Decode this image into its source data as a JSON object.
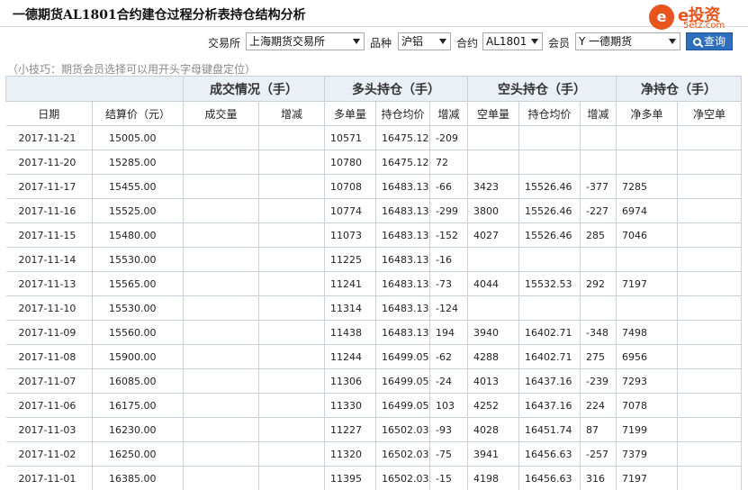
{
  "header": {
    "title": "一德期货AL1801合约建仓过程分析表持仓结构分析",
    "logo_mark": "e",
    "logo_brand": "e投资",
    "logo_site": "5etz.com"
  },
  "filters": {
    "exchange_label": "交易所",
    "exchange_value": "上海期货交易所",
    "variety_label": "品种",
    "variety_value": "沪铝",
    "contract_label": "合约",
    "contract_value": "AL1801",
    "member_label": "会员",
    "member_value": "Y 一德期货",
    "query_label": "查询"
  },
  "tip": "（小技巧：期货会员选择可以用开头字母键盘定位）",
  "table": {
    "group_headers": [
      "成交情况（手）",
      "多头持仓（手）",
      "空头持仓（手）",
      "净持仓（手）"
    ],
    "columns": [
      "日期",
      "结算价（元）",
      "成交量",
      "增减",
      "多单量",
      "持仓均价",
      "增减",
      "空单量",
      "持仓均价",
      "增减",
      "净多单",
      "净空单"
    ],
    "rows": [
      {
        "date": "2017-11-21",
        "settle": "15005.00",
        "long_qty": "10571",
        "long_avg": "16475.12",
        "long_chg": "-209",
        "long_dir": "down",
        "short_qty": "",
        "short_avg": "",
        "short_chg": "",
        "short_dir": "",
        "net_long": "",
        "net_short": ""
      },
      {
        "date": "2017-11-20",
        "settle": "15285.00",
        "long_qty": "10780",
        "long_avg": "16475.12",
        "long_chg": "72",
        "long_dir": "up",
        "short_qty": "",
        "short_avg": "",
        "short_chg": "",
        "short_dir": "",
        "net_long": "",
        "net_short": ""
      },
      {
        "date": "2017-11-17",
        "settle": "15455.00",
        "long_qty": "10708",
        "long_avg": "16483.13",
        "long_chg": "-66",
        "long_dir": "down",
        "short_qty": "3423",
        "short_avg": "15526.46",
        "short_chg": "-377",
        "short_dir": "down",
        "net_long": "7285",
        "net_short": ""
      },
      {
        "date": "2017-11-16",
        "settle": "15525.00",
        "long_qty": "10774",
        "long_avg": "16483.13",
        "long_chg": "-299",
        "long_dir": "down",
        "short_qty": "3800",
        "short_avg": "15526.46",
        "short_chg": "-227",
        "short_dir": "down",
        "net_long": "6974",
        "net_short": ""
      },
      {
        "date": "2017-11-15",
        "settle": "15480.00",
        "long_qty": "11073",
        "long_avg": "16483.13",
        "long_chg": "-152",
        "long_dir": "down",
        "short_qty": "4027",
        "short_avg": "15526.46",
        "short_chg": "285",
        "short_dir": "up",
        "net_long": "7046",
        "net_short": ""
      },
      {
        "date": "2017-11-14",
        "settle": "15530.00",
        "long_qty": "11225",
        "long_avg": "16483.13",
        "long_chg": "-16",
        "long_dir": "down",
        "short_qty": "",
        "short_avg": "",
        "short_chg": "",
        "short_dir": "",
        "net_long": "",
        "net_short": ""
      },
      {
        "date": "2017-11-13",
        "settle": "15565.00",
        "long_qty": "11241",
        "long_avg": "16483.13",
        "long_chg": "-73",
        "long_dir": "down",
        "short_qty": "4044",
        "short_avg": "15532.53",
        "short_chg": "292",
        "short_dir": "up",
        "net_long": "7197",
        "net_short": ""
      },
      {
        "date": "2017-11-10",
        "settle": "15530.00",
        "long_qty": "11314",
        "long_avg": "16483.13",
        "long_chg": "-124",
        "long_dir": "down",
        "short_qty": "",
        "short_avg": "",
        "short_chg": "",
        "short_dir": "",
        "net_long": "",
        "net_short": ""
      },
      {
        "date": "2017-11-09",
        "settle": "15560.00",
        "long_qty": "11438",
        "long_avg": "16483.13",
        "long_chg": "194",
        "long_dir": "up",
        "short_qty": "3940",
        "short_avg": "16402.71",
        "short_chg": "-348",
        "short_dir": "down",
        "net_long": "7498",
        "net_short": ""
      },
      {
        "date": "2017-11-08",
        "settle": "15900.00",
        "long_qty": "11244",
        "long_avg": "16499.05",
        "long_chg": "-62",
        "long_dir": "down",
        "short_qty": "4288",
        "short_avg": "16402.71",
        "short_chg": "275",
        "short_dir": "up",
        "net_long": "6956",
        "net_short": ""
      },
      {
        "date": "2017-11-07",
        "settle": "16085.00",
        "long_qty": "11306",
        "long_avg": "16499.05",
        "long_chg": "-24",
        "long_dir": "down",
        "short_qty": "4013",
        "short_avg": "16437.16",
        "short_chg": "-239",
        "short_dir": "down",
        "net_long": "7293",
        "net_short": ""
      },
      {
        "date": "2017-11-06",
        "settle": "16175.00",
        "long_qty": "11330",
        "long_avg": "16499.05",
        "long_chg": "103",
        "long_dir": "up",
        "short_qty": "4252",
        "short_avg": "16437.16",
        "short_chg": "224",
        "short_dir": "up",
        "net_long": "7078",
        "net_short": ""
      },
      {
        "date": "2017-11-03",
        "settle": "16230.00",
        "long_qty": "11227",
        "long_avg": "16502.03",
        "long_chg": "-93",
        "long_dir": "down",
        "short_qty": "4028",
        "short_avg": "16451.74",
        "short_chg": "87",
        "short_dir": "up",
        "net_long": "7199",
        "net_short": ""
      },
      {
        "date": "2017-11-02",
        "settle": "16250.00",
        "long_qty": "11320",
        "long_avg": "16502.03",
        "long_chg": "-75",
        "long_dir": "down",
        "short_qty": "3941",
        "short_avg": "16456.63",
        "short_chg": "-257",
        "short_dir": "down",
        "net_long": "7379",
        "net_short": ""
      },
      {
        "date": "2017-11-01",
        "settle": "16385.00",
        "long_qty": "11395",
        "long_avg": "16502.03",
        "long_chg": "-15",
        "long_dir": "down",
        "short_qty": "4198",
        "short_avg": "16456.63",
        "short_chg": "316",
        "short_dir": "up",
        "net_long": "7197",
        "net_short": ""
      }
    ]
  },
  "colors": {
    "increase": "#dd0000",
    "decrease": "#008800",
    "header_bg": "#eaf0f6",
    "button": "#2d6ebd",
    "brand": "#e8541c"
  }
}
